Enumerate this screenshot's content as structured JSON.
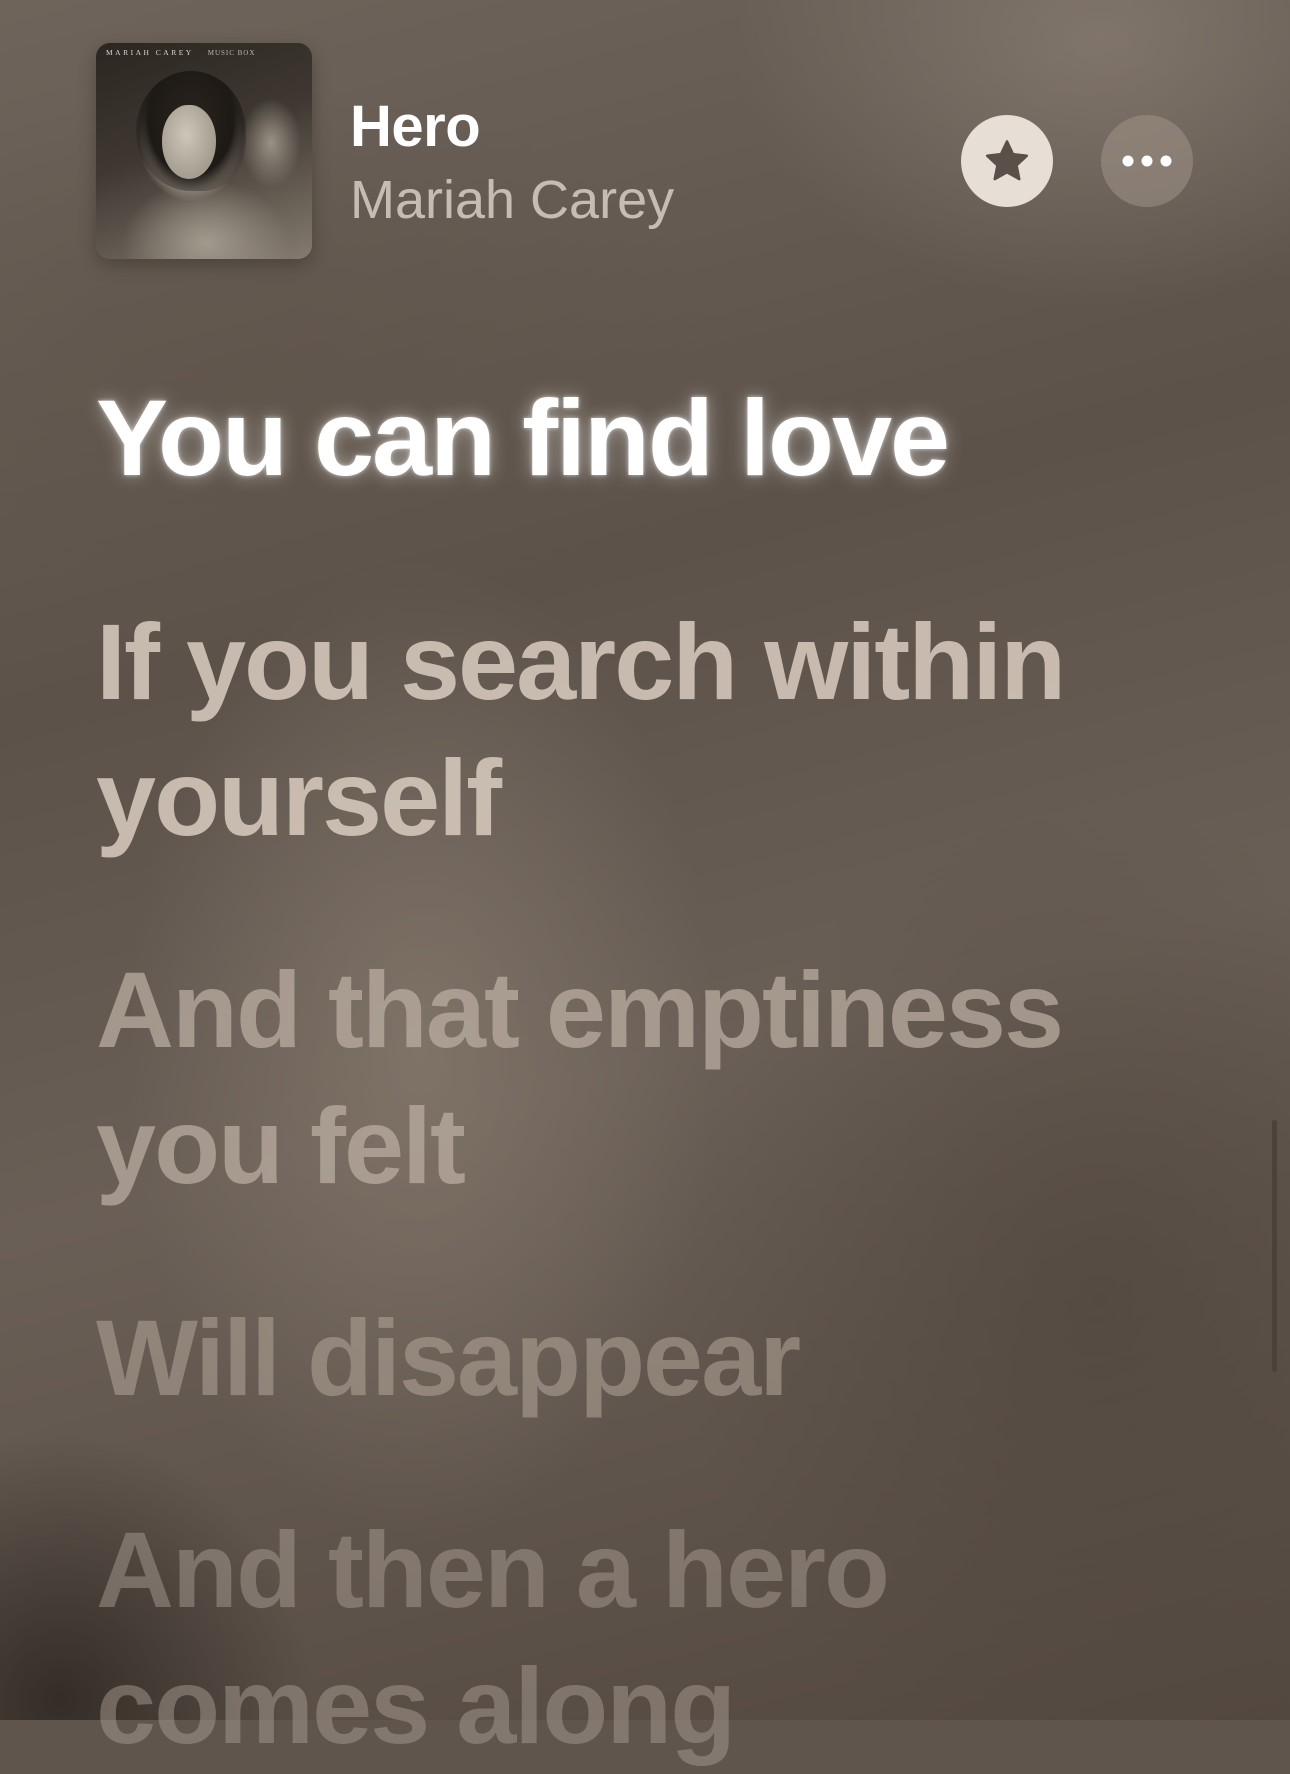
{
  "now_playing": {
    "title": "Hero",
    "artist": "Mariah Carey",
    "album_art": {
      "artist_text": "MARIAH CAREY",
      "album_text": "MUSIC BOX"
    }
  },
  "actions": {
    "favorite_icon": "star-icon",
    "more_icon": "ellipsis-icon"
  },
  "lyrics": {
    "lines": [
      "You can find love",
      "If you search within yourself",
      "And that emptiness you felt",
      "Will disappear",
      "And then a hero comes along"
    ],
    "active_index": 0
  },
  "colors": {
    "active_lyric": "#ffffff",
    "favorite_button": "#e7dfd6",
    "background": "#5f554d"
  }
}
